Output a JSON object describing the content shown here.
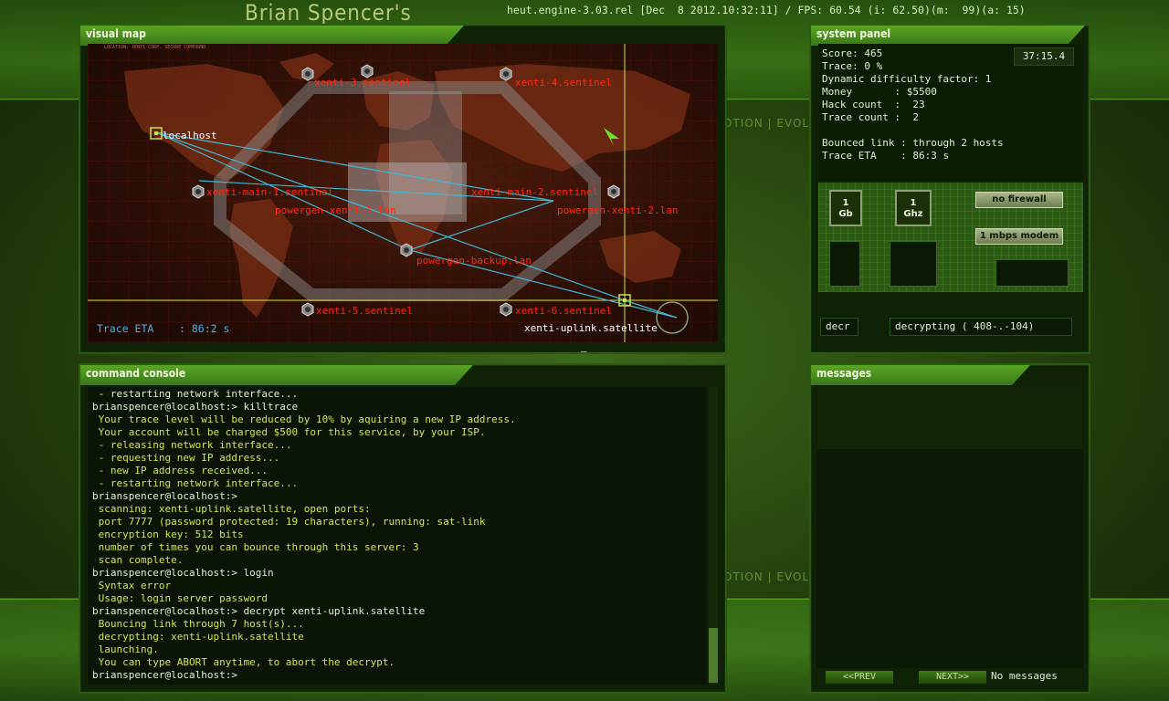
{
  "app": {
    "title": "Brian Spencer's",
    "engine_status": "heut.engine-3.03.rel [Dec  8 2012.10:32:11] / FPS: 60.54 (i: 62.50)(m:  99)(a: 15)"
  },
  "background": {
    "evolution_text": "OTION | EVOLUTION"
  },
  "visual_map": {
    "title": "visual map",
    "location_text": "LOCATION: XENTI CORP. SECURE COMPOUND",
    "trace_eta": "Trace ETA    : 86:2 s",
    "collapse_label": "–",
    "nodes": [
      {
        "label": "xenti-3.sentinel",
        "color": "red"
      },
      {
        "label": "xenti-4.sentinel",
        "color": "red"
      },
      {
        "label": "localhost",
        "color": "white"
      },
      {
        "label": "xenti-main-1.sentinel",
        "color": "red"
      },
      {
        "label": "xenti-main-2.sentinel",
        "color": "red"
      },
      {
        "label": "powergen-xenti-1.lan",
        "color": "red"
      },
      {
        "label": "powergen-xenti-2.lan",
        "color": "red"
      },
      {
        "label": "powergen-backup.lan",
        "color": "red"
      },
      {
        "label": "xenti-5.sentinel",
        "color": "red"
      },
      {
        "label": "xenti-6.sentinel",
        "color": "red"
      },
      {
        "label": "xenti-uplink.satellite",
        "color": "white"
      }
    ]
  },
  "system_panel": {
    "title": "system panel",
    "clock": "37:15.4",
    "lines": [
      "Score: 465",
      "Trace: 0 %",
      "Dynamic difficulty factor: 1",
      "Money       : $5500",
      "Hack count  :  23",
      "Trace count :  2",
      "",
      "Bounced link : through 2 hosts",
      "Trace ETA    : 86:3 s"
    ],
    "hardware": {
      "ram": "1\nGb",
      "cpu": "1\nGhz",
      "firewall": "no firewall",
      "modem": "1 mbps modem"
    },
    "task_name": "decr",
    "task_status": "decrypting ( 408-.-104)"
  },
  "command_console": {
    "title": "command console",
    "lines": [
      {
        "text": " - restarting network interface...",
        "style": "normal"
      },
      {
        "text": "brianspencer@localhost:> killtrace",
        "style": "normal"
      },
      {
        "text": " Your trace level will be reduced by 10% by aquiring a new IP address.",
        "style": "yellow"
      },
      {
        "text": " Your account will be charged $500 for this service, by your ISP.",
        "style": "yellow"
      },
      {
        "text": " - releasing network interface...",
        "style": "yellow"
      },
      {
        "text": " - requesting new IP address...",
        "style": "yellow"
      },
      {
        "text": " - new IP address received...",
        "style": "yellow"
      },
      {
        "text": " - restarting network interface...",
        "style": "yellow"
      },
      {
        "text": "brianspencer@localhost:>",
        "style": "normal"
      },
      {
        "text": " scanning: xenti-uplink.satellite, open ports:",
        "style": "yellow"
      },
      {
        "text": " port 7777 (password protected: 19 characters), running: sat-link",
        "style": "yellow"
      },
      {
        "text": " encryption key: 512 bits",
        "style": "yellow"
      },
      {
        "text": " number of times you can bounce through this server: 3",
        "style": "yellow"
      },
      {
        "text": " scan complete.",
        "style": "yellow"
      },
      {
        "text": "brianspencer@localhost:> login",
        "style": "normal"
      },
      {
        "text": " Syntax error",
        "style": "yellow"
      },
      {
        "text": " Usage: login server password",
        "style": "yellow"
      },
      {
        "text": "brianspencer@localhost:> decrypt xenti-uplink.satellite",
        "style": "normal"
      },
      {
        "text": " Bouncing link through 7 host(s)...",
        "style": "yellow"
      },
      {
        "text": " decrypting: xenti-uplink.satellite",
        "style": "yellow"
      },
      {
        "text": " launching.",
        "style": "yellow"
      },
      {
        "text": " You can type ABORT anytime, to abort the decrypt.",
        "style": "yellow"
      },
      {
        "text": "brianspencer@localhost:>",
        "style": "normal"
      }
    ]
  },
  "messages": {
    "title": "messages",
    "prev_label": "<<PREV",
    "next_label": "NEXT>>",
    "status": "No messages"
  },
  "colors": {
    "panel_header": "#5aa524",
    "node_red": "#ff2a14",
    "trace_line": "#3fb8d8",
    "crosshair": "#c8e64a",
    "console_yellow": "#d6e64c"
  }
}
